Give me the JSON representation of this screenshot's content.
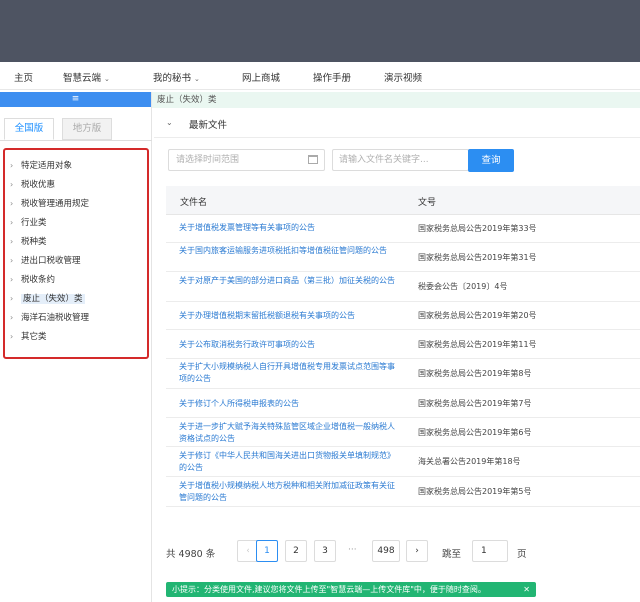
{
  "nav": {
    "items": [
      {
        "label": "主页",
        "dropdown": false
      },
      {
        "label": "智慧云端",
        "dropdown": true
      },
      {
        "label": "我的秘书",
        "dropdown": true
      },
      {
        "label": "网上商城",
        "dropdown": false
      },
      {
        "label": "操作手册",
        "dropdown": false
      },
      {
        "label": "演示视频",
        "dropdown": false
      }
    ],
    "caret": "⌄"
  },
  "sidebar": {
    "header_icon": "≡",
    "tabs": [
      "全国版",
      "地方版"
    ],
    "categories": [
      {
        "label": "特定适用对象",
        "selected": false
      },
      {
        "label": "税收优惠",
        "selected": false
      },
      {
        "label": "税收管理通用规定",
        "selected": false
      },
      {
        "label": "行业类",
        "selected": false
      },
      {
        "label": "税种类",
        "selected": false
      },
      {
        "label": "进出口税收管理",
        "selected": false
      },
      {
        "label": "税收条约",
        "selected": false
      },
      {
        "label": "废止（失效）类",
        "selected": true
      },
      {
        "label": "海洋石油税收管理",
        "selected": false
      },
      {
        "label": "其它类",
        "selected": false
      }
    ],
    "arrow": "›"
  },
  "breadcrumb": "废止（失效）类",
  "section": {
    "title": "最新文件",
    "chevron": "⌄"
  },
  "filters": {
    "date_placeholder": "请选择时间范围",
    "keyword_placeholder": "请输入文件名关键字...",
    "search_label": "查询"
  },
  "table": {
    "headers": [
      "文件名",
      "文号"
    ],
    "rows": [
      {
        "title": "关于增值税发票管理等有关事项的公告",
        "number": "国家税务总局公告2019年第33号"
      },
      {
        "title": "关于国内旅客运输服务进项税抵扣等增值税征管问题的公告",
        "number": "国家税务总局公告2019年第31号"
      },
      {
        "title": "关于对原产于美国的部分进口商品（第三批）加征关税的公告",
        "number": "税委会公告〔2019〕4号"
      },
      {
        "title": "关于办理增值税期末留抵税额退税有关事项的公告",
        "number": "国家税务总局公告2019年第20号"
      },
      {
        "title": "关于公布取消税务行政许可事项的公告",
        "number": "国家税务总局公告2019年第11号"
      },
      {
        "title": "关于扩大小规模纳税人自行开具增值税专用发票试点范围等事项的公告",
        "number": "国家税务总局公告2019年第8号"
      },
      {
        "title": "关于修订个人所得税申报表的公告",
        "number": "国家税务总局公告2019年第7号"
      },
      {
        "title": "关于进一步扩大赋予海关特殊监管区域企业增值税一般纳税人资格试点的公告",
        "number": "国家税务总局公告2019年第6号"
      },
      {
        "title": "关于修订《中华人民共和国海关进出口货物报关单填制规范》的公告",
        "number": "海关总署公告2019年第18号"
      },
      {
        "title": "关于增值税小规模纳税人地方税种和相关附加减征政策有关征管问题的公告",
        "number": "国家税务总局公告2019年第5号"
      }
    ]
  },
  "pager": {
    "total": "共 4980 条",
    "prev": "‹",
    "next": "›",
    "pages": [
      "1",
      "2",
      "3"
    ],
    "ellipsis": "···",
    "last": "498",
    "current": "1",
    "jump_label": "跳至",
    "jump_value": "1",
    "unit": "页"
  },
  "tip": {
    "text": "小提示：分类使用文件,建议您将文件上传至\"智慧云端—上传文件库\"中，便于随时查阅。",
    "close": "✕"
  }
}
